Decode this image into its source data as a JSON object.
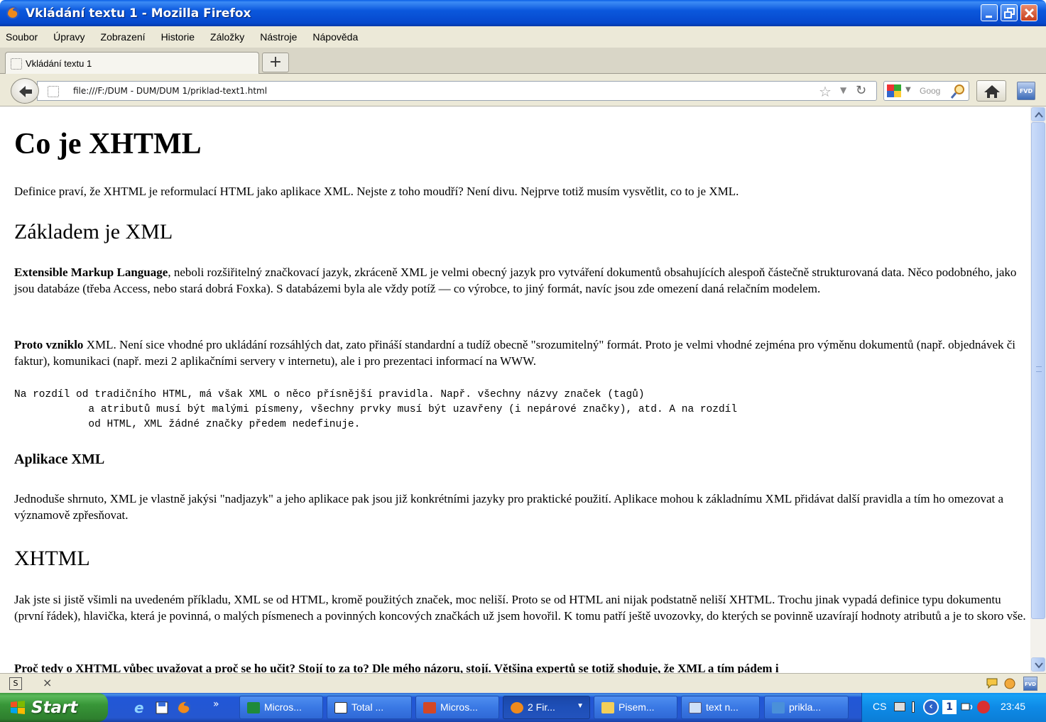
{
  "window": {
    "title": "Vkládání textu 1 - Mozilla Firefox"
  },
  "menu": [
    {
      "label": "Soubor"
    },
    {
      "label": "Úpravy"
    },
    {
      "label": "Zobrazení"
    },
    {
      "label": "Historie"
    },
    {
      "label": "Záložky"
    },
    {
      "label": "Nástroje"
    },
    {
      "label": "Nápověda"
    }
  ],
  "tabs": {
    "active_label": "Vkládání textu 1",
    "new_tab_label": "+"
  },
  "navbar": {
    "url": "file:///F:/DUM - DUM/DUM 1/priklad-text1.html",
    "search_placeholder": "Goog"
  },
  "content": {
    "h1": "Co je XHTML",
    "p1": "Definice praví, že XHTML je reformulací HTML jako aplikace XML. Nejste z toho moudří? Není divu. Nejprve totiž musím vysvětlit, co to je XML.",
    "h2_1": "Základem je XML",
    "p2_bold": "Extensible Markup Language",
    "p2_rest": ", neboli rozšiřitelný značkovací jazyk, zkráceně XML je velmi obecný jazyk pro vytváření dokumentů obsahujících alespoň částečně strukturovaná data. Něco podobného, jako jsou databáze (třeba Access, nebo stará dobrá Foxka). S databázemi byla ale vždy potíž — co výrobce, to jiný formát, navíc jsou zde omezení daná relačním modelem.",
    "p3_bold": "Proto vzniklo",
    "p3_rest": " XML. Není sice vhodné pro ukládání rozsáhlých dat, zato přináší standardní a tudíž obecně \"srozumitelný\" formát. Proto je velmi vhodné zejména pro výměnu dokumentů (např. objednávek či faktur), komunikaci (např. mezi 2 aplikačními servery v internetu), ale i pro prezentaci informací na WWW.",
    "pre": "Na rozdíl od tradičního HTML, má však XML o něco přísnější pravidla. Např. všechny názvy značek (tagů)\n            a atributů musí být malými písmeny, všechny prvky musí být uzavřeny (i nepárové značky), atd. A na rozdíl\n            od HTML, XML žádné značky předem nedefinuje.",
    "h3": "Aplikace XML",
    "p4": "Jednoduše shrnuto, XML je vlastně jakýsi \"nadjazyk\" a jeho aplikace pak jsou již konkrétními jazyky pro praktické použití. Aplikace mohou k základnímu XML přidávat další pravidla a tím ho omezovat a významově zpřesňovat.",
    "h2_2": "XHTML",
    "p5": "Jak jste si jistě všimli na uvedeném příkladu, XML se od HTML, kromě použitých značek, moc neliší. Proto se od HTML ani nijak podstatně neliší XHTML. Trochu jinak vypadá definice typu dokumentu (první řádek), hlavička, která je povinná, o malých písmenech a povinných koncových značkách už jsem hovořil. K tomu patří ještě uvozovky, do kterých se povinně uzavírají hodnoty atributů a je to skoro vše.",
    "p6": "Proč tedy o XHTML vůbec uvažovat a proč se ho učit? Stojí to za to? Dle mého názoru, stojí. Většina expertů se totiž shoduje, že XML a tím pádem i"
  },
  "addonbar": {
    "close_label": "×"
  },
  "taskbar": {
    "start_label": "Start",
    "buttons": [
      {
        "label": "Micros..."
      },
      {
        "label": "Total ..."
      },
      {
        "label": "Micros..."
      },
      {
        "label": "2 Fir..."
      },
      {
        "label": "Pisem..."
      },
      {
        "label": "text n..."
      },
      {
        "label": "prikla..."
      }
    ],
    "lang": "CS",
    "tray_num": "1",
    "clock": "23:45"
  },
  "colors": {
    "title_bar": "#0b58dd",
    "taskbar": "#2557d0",
    "start_button": "#389638",
    "tray": "#0e8ae6"
  }
}
